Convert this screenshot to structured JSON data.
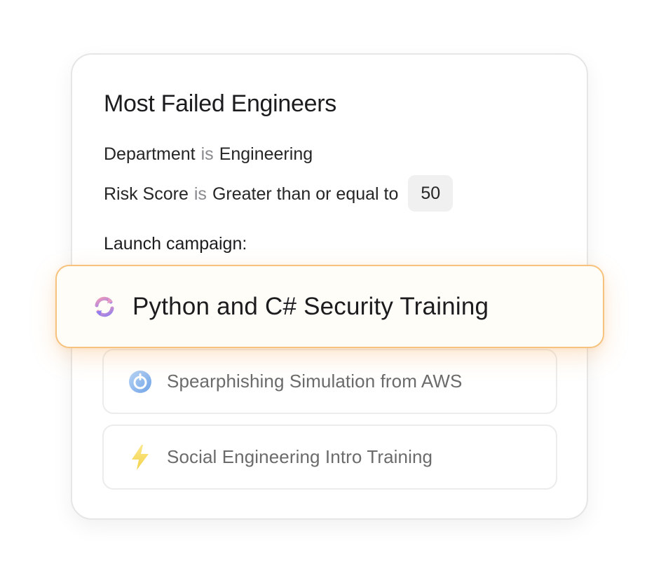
{
  "card": {
    "title": "Most Failed Engineers",
    "filters": [
      {
        "field": "Department",
        "operator": "is",
        "value": "Engineering"
      },
      {
        "field": "Risk Score",
        "operator": "is",
        "value": "Greater than or equal to",
        "chip": "50"
      }
    ],
    "launch_label": "Launch campaign:",
    "campaigns": [
      {
        "label": "Python and C# Security Training",
        "icon": "sync-icon",
        "selected": true
      },
      {
        "label": "Spearphishing Simulation from AWS",
        "icon": "timer-icon",
        "selected": false
      },
      {
        "label": "Social Engineering Intro Training",
        "icon": "lightning-icon",
        "selected": false
      }
    ]
  },
  "colors": {
    "selected_border": "#f6c27d",
    "operator_text": "#8a8a8e",
    "chip_bg": "#f0f0f0"
  }
}
